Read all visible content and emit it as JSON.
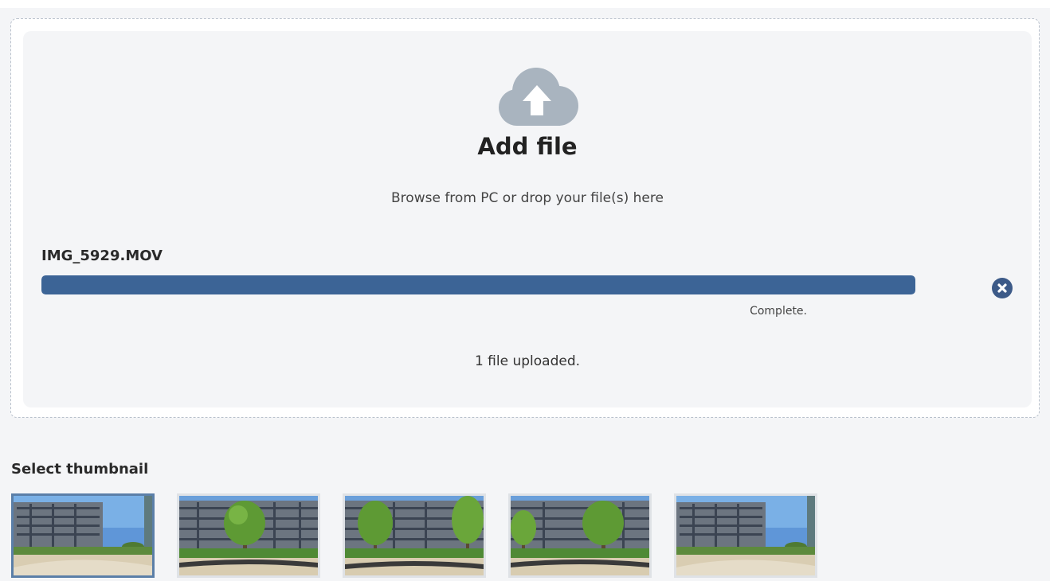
{
  "upload": {
    "title": "Add file",
    "subtitle": "Browse from PC or drop your file(s) here",
    "upload_icon": "cloud-upload-icon",
    "file": {
      "name": "IMG_5929.MOV",
      "progress_percent": 100,
      "status": "Complete.",
      "remove_icon": "close-circle-icon"
    },
    "summary": "1 file uploaded."
  },
  "thumbnails": {
    "heading": "Select thumbnail",
    "selected_index": 0,
    "items": [
      {
        "scene": "building-wide"
      },
      {
        "scene": "building-tree"
      },
      {
        "scene": "building-trees"
      },
      {
        "scene": "building-tree"
      },
      {
        "scene": "building-wide"
      }
    ]
  },
  "colors": {
    "accent": "#3c6496",
    "remove_button": "#3c5a88",
    "icon_gray": "#a9b4bf",
    "panel_bg": "#f4f5f7"
  }
}
